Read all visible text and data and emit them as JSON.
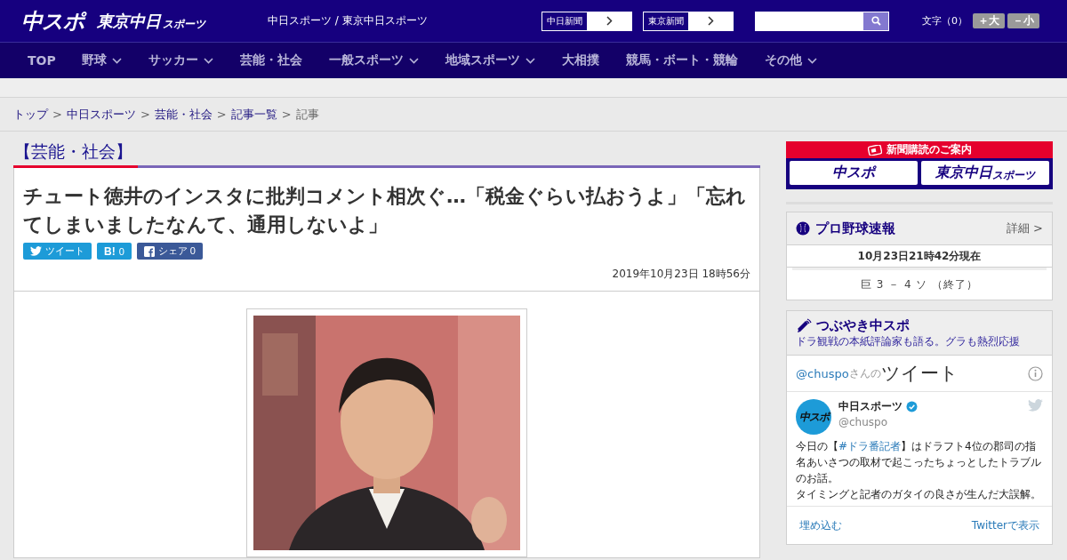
{
  "header": {
    "logo_main": "中スポ",
    "logo_tokyo": "東京中日",
    "logo_tokyo_small": "スポーツ",
    "tagline": "中日スポーツ / 東京中日スポーツ",
    "paper_links": [
      "中日新聞",
      "東京新聞"
    ],
    "font_size": {
      "label": "文字（0）",
      "buttons": [
        "＋大",
        "－小"
      ]
    }
  },
  "nav": [
    {
      "label": "TOP",
      "has_menu": false
    },
    {
      "label": "野球",
      "has_menu": true
    },
    {
      "label": "サッカー",
      "has_menu": true
    },
    {
      "label": "芸能・社会",
      "has_menu": false
    },
    {
      "label": "一般スポーツ",
      "has_menu": true
    },
    {
      "label": "地域スポーツ",
      "has_menu": true
    },
    {
      "label": "大相撲",
      "has_menu": false
    },
    {
      "label": "競馬・ボート・競輪",
      "has_menu": false
    },
    {
      "label": "その他",
      "has_menu": true
    }
  ],
  "breadcrumb_separator": ">",
  "breadcrumb": [
    {
      "label": "トップ",
      "link": true
    },
    {
      "label": "中日スポーツ",
      "link": true
    },
    {
      "label": "芸能・社会",
      "link": true
    },
    {
      "label": "記事一覧",
      "link": true
    },
    {
      "label": "記事",
      "link": false
    }
  ],
  "section_title": "【芸能・社会】",
  "article": {
    "title": "チュート徳井のインスタに批判コメント相次ぐ…「税金ぐらい払おうよ」「忘れてしまいましたなんて、通用しないよ」",
    "share": [
      {
        "kind": "twitter",
        "label": "ツイート"
      },
      {
        "kind": "hatena",
        "label": "B!",
        "count": "0"
      },
      {
        "kind": "facebook",
        "label": "シェア",
        "count": "0"
      }
    ],
    "date": "2019年10月23日 18時56分"
  },
  "sidebar": {
    "subscribe": {
      "title": "新聞購読のご案内",
      "logos": [
        "中スポ",
        "東京中日"
      ],
      "logo_small": "スポーツ"
    },
    "baseball": {
      "title": "プロ野球速報",
      "detail": "詳細 >",
      "time": "10月23日21時42分現在",
      "score": "巨 3 － 4 ソ （終了）"
    },
    "tweets": {
      "title": "つぶやき中スポ",
      "subtitle": "ドラ観戦の本紙評論家も語る。グラも熱烈応援",
      "handle": "@chuspo",
      "handle_suffix": "さんの",
      "heading": "ツイート",
      "tweet": {
        "avatar_text": "中スポ",
        "name": "中日スポーツ",
        "verified": true,
        "user": "@chuspo",
        "text": [
          {
            "kind": "plain",
            "text": "今日の【"
          },
          {
            "kind": "hashtag",
            "text": "#ドラ番記者"
          },
          {
            "kind": "plain",
            "text": "】はドラフト4位の郡司の指名あいさつの取材で起こったちょっとしたトラブルのお話。"
          },
          {
            "kind": "break"
          },
          {
            "kind": "plain",
            "text": "タイミングと記者のガタイの良さが生んだ大誤解。"
          }
        ]
      },
      "footer": [
        "埋め込む",
        "Twitterで表示"
      ]
    }
  }
}
